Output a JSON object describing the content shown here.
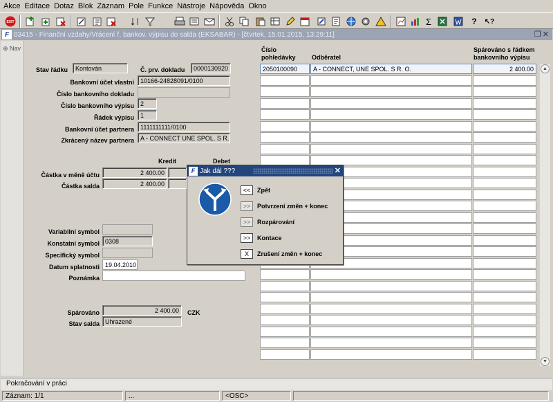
{
  "menubar": [
    "Akce",
    "Editace",
    "Dotaz",
    "Blok",
    "Záznam",
    "Pole",
    "Funkce",
    "Nástroje",
    "Nápověda",
    "Okno"
  ],
  "toolbar": {
    "exit_label": "EXIT"
  },
  "window": {
    "title": "03415 - Finanční vzdahy/Vrácení ř. bankov. výpisu do salda (EKSABAR) - [čtvrtek, 15.01.2015, 13:29:11]"
  },
  "nav": {
    "label": "Nav"
  },
  "form": {
    "stav_radku": {
      "label": "Stav řádku",
      "value": "Kontován"
    },
    "c_prv_dokladu": {
      "label": "Č. prv. dokladu",
      "value": "0000130920"
    },
    "bankovni_ucet_vlastni": {
      "label": "Bankovní účet vlastní",
      "value": "10166-24828091/0100"
    },
    "cislo_bankovniho_dokladu": {
      "label": "Číslo bankovního dokladu",
      "value": ""
    },
    "cislo_bankovniho_vypisu": {
      "label": "Číslo bankovního výpisu",
      "value": "2"
    },
    "radek_vypisu": {
      "label": "Řádek výpisu",
      "value": "1"
    },
    "bankovni_ucet_partnera": {
      "label": "Bankovní účet partnera",
      "value": "1111111111/0100"
    },
    "zkraceny_nazev_partnera": {
      "label": "Zkrácený název partnera",
      "value": "A - CONNECT UNE SPOL. S R. O."
    },
    "kredit_header": "Kredit",
    "debet_header": "Debet",
    "castka_v_mene_uctu": {
      "label": "Částka v měně účtu",
      "kredit": "2 400.00"
    },
    "castka_salda": {
      "label": "Částka salda",
      "kredit": "2 400.00"
    },
    "variabilni_symbol": {
      "label": "Variabilní symbol",
      "value": ""
    },
    "konstantni_symbol": {
      "label": "Konstatní symbol",
      "value": "0308"
    },
    "specificky_symbol": {
      "label": "Specifický symbol",
      "value": ""
    },
    "datum_splatnosti": {
      "label": "Datum splatnosti",
      "value": "19.04.2010"
    },
    "poznamka": {
      "label": "Poznámka",
      "value": ""
    },
    "sparovano": {
      "label": "Spárováno",
      "value": "2 400.00",
      "currency": "CZK"
    },
    "stav_salda": {
      "label": "Stav salda",
      "value": "Uhrazené"
    }
  },
  "grid": {
    "headers": {
      "col1": [
        "Číslo",
        "pohledávky"
      ],
      "col2": "Odběratel",
      "col3": [
        "Spárováno s řádkem",
        "bankovního výpisu"
      ]
    },
    "rows": [
      {
        "cislo": "2050100090",
        "odberatel": "A - CONNECT, UNE SPOL. S R. O.",
        "sparovano": "2 400.00"
      }
    ]
  },
  "dialog": {
    "title": "Jak dál ???",
    "options": [
      {
        "btn": "<<",
        "label": "Zpět"
      },
      {
        "btn": ">>",
        "label": "Potvrzení změn + konec"
      },
      {
        "btn": ">>",
        "label": "Rozpárování"
      },
      {
        "btn": ">>",
        "label": "Kontace"
      },
      {
        "btn": "X",
        "label": "Zrušení změn + konec"
      }
    ]
  },
  "status": {
    "line1": "Pokračování v práci",
    "record": "Záznam: 1/1",
    "ellipsis": "...",
    "osc": "<OSC>"
  }
}
